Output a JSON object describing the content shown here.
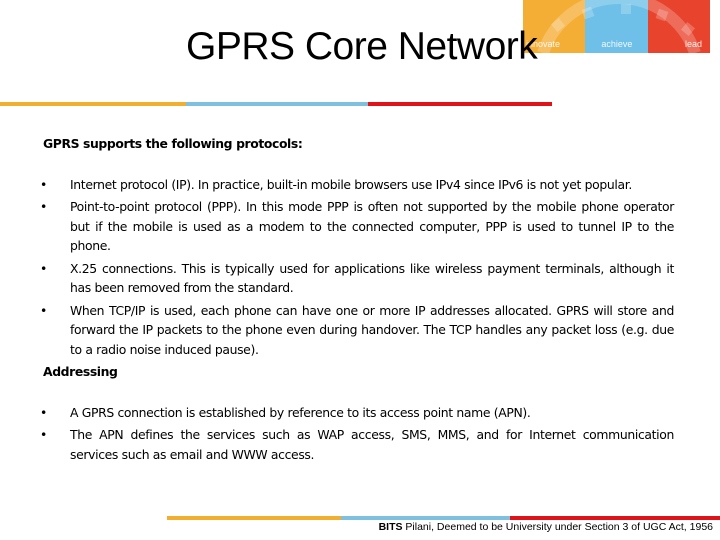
{
  "logo": {
    "segments": [
      {
        "label": "innovate",
        "color": "#f5ae35"
      },
      {
        "label": "achieve",
        "color": "#6ec0e8"
      },
      {
        "label": "lead",
        "color": "#e8432c"
      }
    ]
  },
  "title": "GPRS Core Network",
  "accent_bars": {
    "top": [
      {
        "color": "#f2ae2e"
      },
      {
        "color": "#7fbfdf"
      },
      {
        "color": "#e0121a"
      }
    ],
    "bottom": [
      {
        "color": "#f2ae2e"
      },
      {
        "color": "#7fbfdf"
      },
      {
        "color": "#e0121a"
      }
    ]
  },
  "content": {
    "intro": "GPRS supports the following protocols:",
    "protocols": [
      "Internet protocol (IP). In practice, built-in mobile browsers use IPv4 since IPv6 is not yet popular.",
      "Point-to-point protocol (PPP). In this mode PPP is often not supported by the mobile phone operator but if the mobile is used as a modem to the connected computer, PPP is used to tunnel IP to the phone.",
      "X.25 connections. This is typically used for applications like wireless payment terminals, although it has been removed from the standard.",
      "When TCP/IP is used, each phone can have one or more IP addresses allocated. GPRS will store and forward the IP packets to the phone even during handover. The TCP handles any packet loss (e.g. due to a radio noise induced pause)."
    ],
    "addressing_heading": "Addressing",
    "addressing": [
      "A GPRS connection is established by reference to its access point name (APN).",
      "The APN defines the services such as WAP access, SMS, MMS, and for Internet communication services such as email and WWW access."
    ],
    "bullet_glyph": "•"
  },
  "footer": {
    "bold": "BITS",
    "text": " Pilani, Deemed to be University under Section 3 of UGC Act, 1956"
  }
}
